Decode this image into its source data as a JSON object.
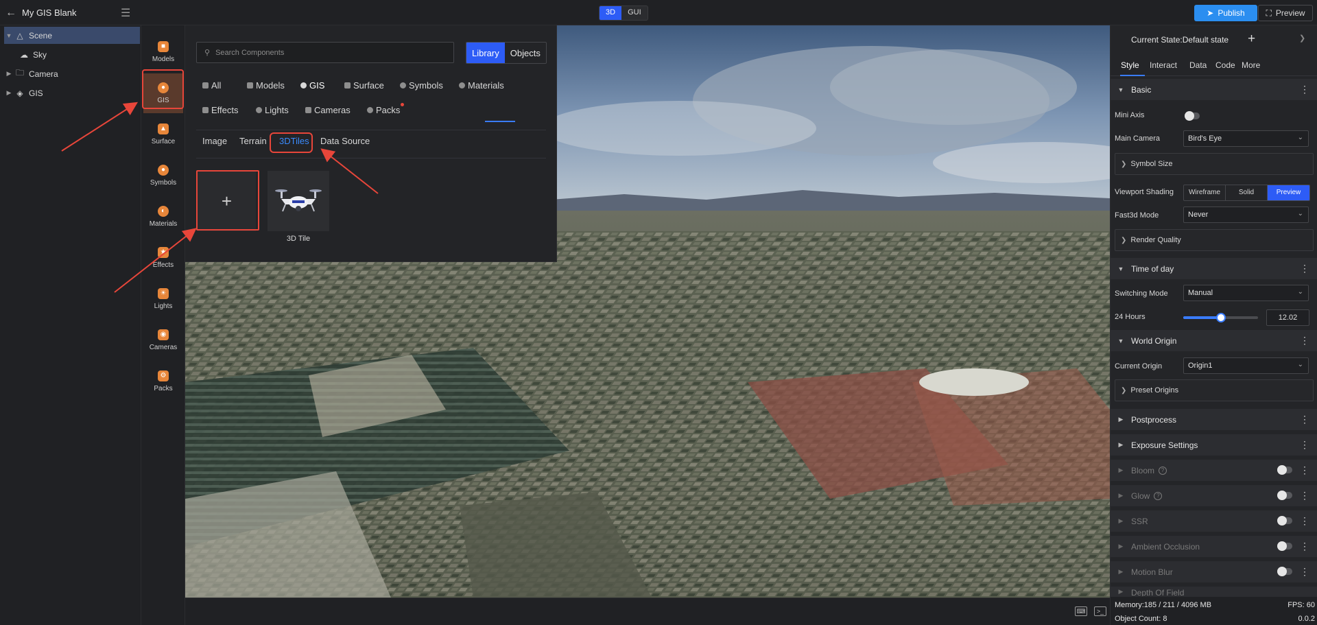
{
  "app": {
    "title": "My GIS Blank",
    "view_modes": [
      "3D",
      "GUI"
    ],
    "active_view_mode": "3D",
    "publish_label": "Publish",
    "preview_label": "Preview",
    "accent": "#2d5cf6",
    "annotation_color": "#e8463a"
  },
  "tree": {
    "items": [
      {
        "label": "Scene",
        "icon": "scene-icon"
      },
      {
        "label": "Sky",
        "icon": "sky-icon"
      },
      {
        "label": "Camera",
        "icon": "folder-icon"
      },
      {
        "label": "GIS",
        "icon": "gis-icon"
      }
    ]
  },
  "iconbar": {
    "items": [
      {
        "label": "Models",
        "icon": "models-icon"
      },
      {
        "label": "GIS",
        "icon": "gis-icon"
      },
      {
        "label": "Surface",
        "icon": "surface-icon"
      },
      {
        "label": "Symbols",
        "icon": "symbols-icon"
      },
      {
        "label": "Materials",
        "icon": "materials-icon"
      },
      {
        "label": "Effects",
        "icon": "effects-icon"
      },
      {
        "label": "Lights",
        "icon": "lights-icon"
      },
      {
        "label": "Cameras",
        "icon": "cameras-icon"
      },
      {
        "label": "Packs",
        "icon": "packs-icon"
      }
    ]
  },
  "library": {
    "search_placeholder": "Search Components",
    "toggle": [
      "Library",
      "Objects"
    ],
    "categories": [
      "All",
      "Models",
      "GIS",
      "Surface",
      "Symbols",
      "Materials",
      "Effects",
      "Lights",
      "Cameras",
      "Packs"
    ],
    "active_category": "GIS",
    "subtabs": [
      "Image",
      "Terrain",
      "3DTiles",
      "Data Source"
    ],
    "active_subtab": "3DTiles",
    "items": [
      {
        "label": "3D Tile"
      }
    ]
  },
  "panel": {
    "state_label": "Current State:Default state",
    "tabs": [
      "Style",
      "Interact",
      "Data",
      "Code",
      "More"
    ],
    "sections": {
      "basic": "Basic",
      "time_of_day": "Time of day",
      "world_origin": "World Origin",
      "postprocess": "Postprocess",
      "exposure": "Exposure Settings",
      "bloom": "Bloom",
      "glow": "Glow",
      "ssr": "SSR",
      "ao": "Ambient Occlusion",
      "motion_blur": "Motion Blur",
      "dof": "Depth Of Field"
    },
    "props": {
      "mini_axis": "Mini Axis",
      "main_camera": "Main Camera",
      "main_camera_value": "Bird's Eye",
      "symbol_size": "Symbol Size",
      "viewport_shading": "Viewport Shading",
      "shading_options": [
        "Wireframe",
        "Solid",
        "Preview"
      ],
      "fast3d_mode": "Fast3d Mode",
      "fast3d_value": "Never",
      "render_quality": "Render Quality",
      "switching_mode": "Switching Mode",
      "switching_value": "Manual",
      "hours_24": "24 Hours",
      "hours_value": "12.02",
      "hours_fraction": 0.5,
      "current_origin": "Current Origin",
      "origin_value": "Origin1",
      "preset_origins": "Preset Origins"
    }
  },
  "status": {
    "memory": "Memory:185 / 211 / 4096 MB",
    "fps": "FPS: 60",
    "object_count": "Object Count: 8",
    "version": "0.0.2"
  }
}
